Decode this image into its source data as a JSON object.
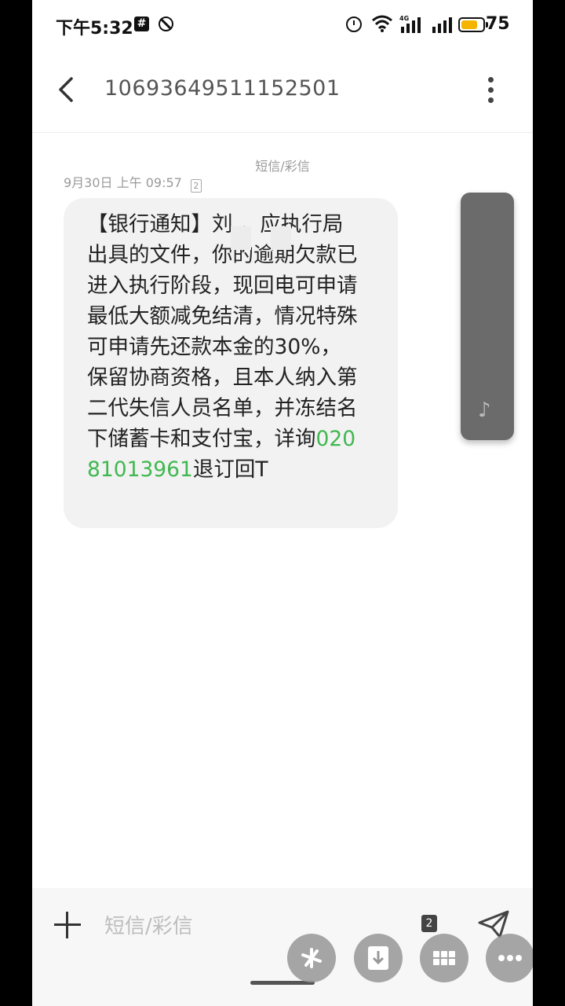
{
  "status_bar": {
    "time": "下午5:32",
    "network": "4G",
    "battery_level": "75",
    "battery_fraction": 0.75
  },
  "header": {
    "title": "10693649511152501"
  },
  "conversation": {
    "channel_label": "短信/彩信",
    "timestamp": "9月30日 上午 09:57",
    "sim": "2",
    "message": {
      "text_before": "【银行通知】刘    ，应执行局出具的文件，你的逾期欠款已进入执行阶段，现回电可申请最低大额减免结清，情况特殊可申请先还款本金的30%，保留协商资格，且本人纳入第二代失信人员名单，并冻结名下储蓄卡和支付宝，详询",
      "phone": "02081013961",
      "text_after": "退订回T"
    }
  },
  "composer": {
    "placeholder": "短信/彩信",
    "sim": "2"
  },
  "icons": {
    "back": "back-arrow-icon",
    "more": "more-vertical-icon",
    "send": "send-icon",
    "plus": "plus-icon",
    "music": "music-note-icon"
  },
  "colors": {
    "link": "#3fb84f",
    "bubble": "#f2f2f2",
    "battery": "#f5b400"
  }
}
